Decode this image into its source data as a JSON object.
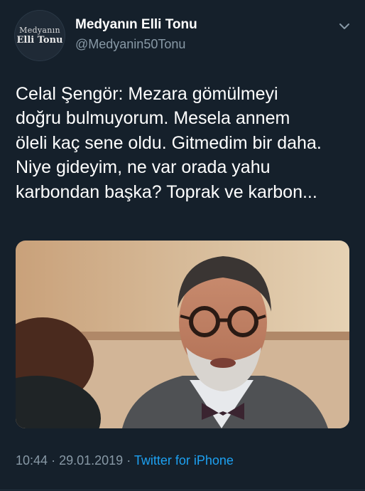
{
  "tweet": {
    "author": {
      "display_name": "Medyanın Elli Tonu",
      "handle": "@Medyanin50Tonu",
      "avatar_line1": "Medyanın",
      "avatar_line2": "Elli Tonu"
    },
    "text": "Celal Şengör: Mezara gömülmeyi\ndoğru bulmuyorum. Mesela annem\nöleli kaç sene oldu. Gitmedim bir daha.\nNiye gideyim, ne var orada yahu\nkarbondan başka? Toprak ve karbon...",
    "time": "10:44",
    "separator": "·",
    "date": "29.01.2019",
    "source": "Twitter for iPhone",
    "menu_icon": "chevron-down-icon"
  },
  "colors": {
    "background": "#15202b",
    "secondary_text": "#8899a6",
    "link": "#1da1f2"
  }
}
